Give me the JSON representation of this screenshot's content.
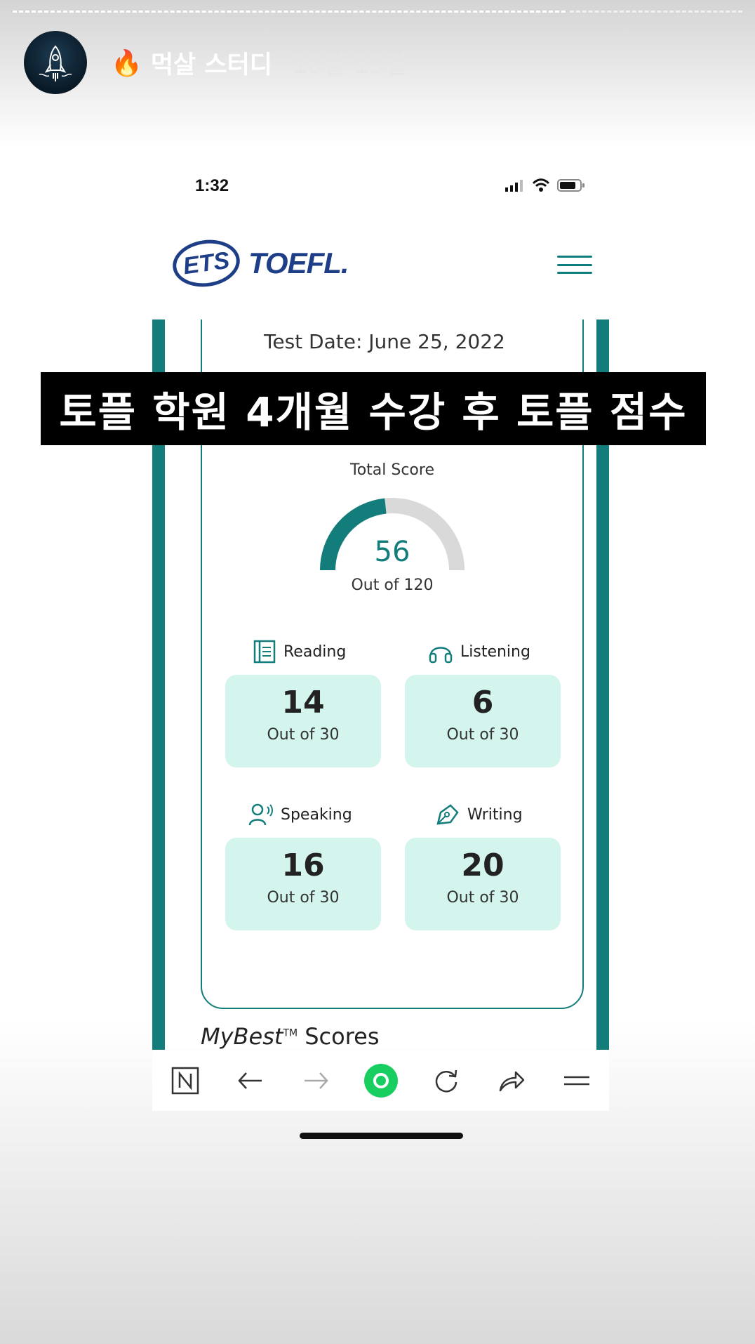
{
  "story": {
    "user_name": "먹살 스터디",
    "posted_date": "10월 13일",
    "fire_emoji": "🔥"
  },
  "phone": {
    "time": "1:32"
  },
  "ets": {
    "logo_ets": "ETS",
    "logo_toefl": "TOEFL."
  },
  "banner": {
    "text": "토플 학원 4개월 수강 후 토플 점수"
  },
  "report": {
    "test_date": "Test Date: June 25, 2022",
    "total": {
      "label": "Total Score",
      "value": "56",
      "out_of": "Out of 120",
      "fraction": 0.4667
    },
    "sections": [
      {
        "name": "Reading",
        "icon": "book-icon",
        "score": "14",
        "out_of": "Out of 30"
      },
      {
        "name": "Listening",
        "icon": "headphones-icon",
        "score": "6",
        "out_of": "Out of 30"
      },
      {
        "name": "Speaking",
        "icon": "speaker-person-icon",
        "score": "16",
        "out_of": "Out of 30"
      },
      {
        "name": "Writing",
        "icon": "pen-icon",
        "score": "20",
        "out_of": "Out of 30"
      }
    ],
    "mybest": {
      "italic": "MyBest",
      "tm": "TM",
      "rest": " Scores"
    }
  },
  "colors": {
    "teal": "#127d7b",
    "score_box": "#d3f5ee",
    "ets_blue": "#1e3f87",
    "naver_green": "#19ce60"
  }
}
